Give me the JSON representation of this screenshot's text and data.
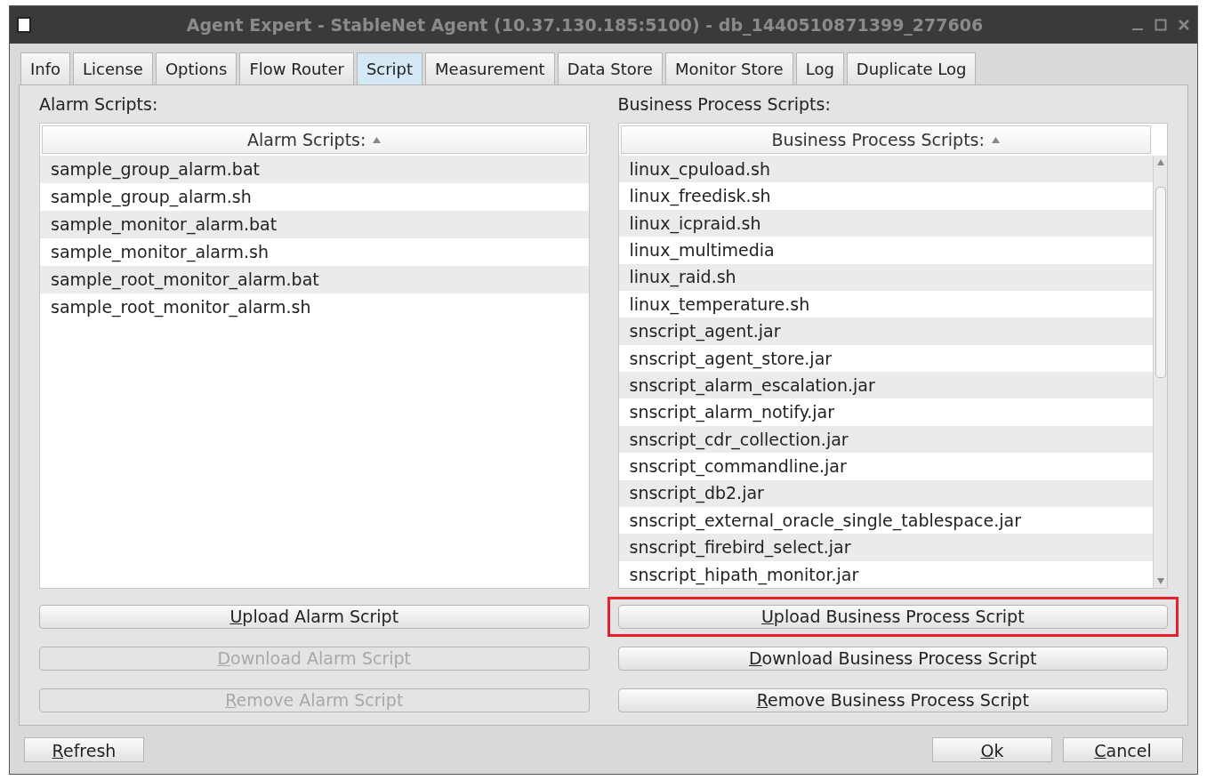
{
  "window": {
    "title": "Agent Expert - StableNet Agent (10.37.130.185:5100) - db_1440510871399_277606"
  },
  "tabs": [
    {
      "label": "Info",
      "selected": false
    },
    {
      "label": "License",
      "selected": false
    },
    {
      "label": "Options",
      "selected": false
    },
    {
      "label": "Flow Router",
      "selected": false
    },
    {
      "label": "Script",
      "selected": true
    },
    {
      "label": "Measurement",
      "selected": false
    },
    {
      "label": "Data Store",
      "selected": false
    },
    {
      "label": "Monitor Store",
      "selected": false
    },
    {
      "label": "Log",
      "selected": false
    },
    {
      "label": "Duplicate Log",
      "selected": false
    }
  ],
  "panels": [
    {
      "label": "Alarm Scripts:",
      "column": "Alarm Scripts:",
      "scrollbar": false,
      "rows": [
        "sample_group_alarm.bat",
        "sample_group_alarm.sh",
        "sample_monitor_alarm.bat",
        "sample_monitor_alarm.sh",
        "sample_root_monitor_alarm.bat",
        "sample_root_monitor_alarm.sh"
      ],
      "buttons": [
        {
          "label": "Upload Alarm Script",
          "disabled": false,
          "highlighted": false
        },
        {
          "label": "Download Alarm Script",
          "disabled": true,
          "highlighted": false
        },
        {
          "label": "Remove Alarm Script",
          "disabled": true,
          "highlighted": false
        }
      ]
    },
    {
      "label": "Business Process Scripts:",
      "column": "Business Process Scripts:",
      "scrollbar": true,
      "rows": [
        "linux_cpuload.sh",
        "linux_freedisk.sh",
        "linux_icpraid.sh",
        "linux_multimedia",
        "linux_raid.sh",
        "linux_temperature.sh",
        "snscript_agent.jar",
        "snscript_agent_store.jar",
        "snscript_alarm_escalation.jar",
        "snscript_alarm_notify.jar",
        "snscript_cdr_collection.jar",
        "snscript_commandline.jar",
        "snscript_db2.jar",
        "snscript_external_oracle_single_tablespace.jar",
        "snscript_firebird_select.jar",
        "snscript_hipath_monitor.jar"
      ],
      "buttons": [
        {
          "label": "Upload Business Process Script",
          "disabled": false,
          "highlighted": true
        },
        {
          "label": "Download Business Process Script",
          "disabled": false,
          "highlighted": false
        },
        {
          "label": "Remove Business Process Script",
          "disabled": false,
          "highlighted": false
        }
      ]
    }
  ],
  "footer": {
    "left": [
      "Refresh"
    ],
    "right": [
      "Ok",
      "Cancel"
    ]
  }
}
